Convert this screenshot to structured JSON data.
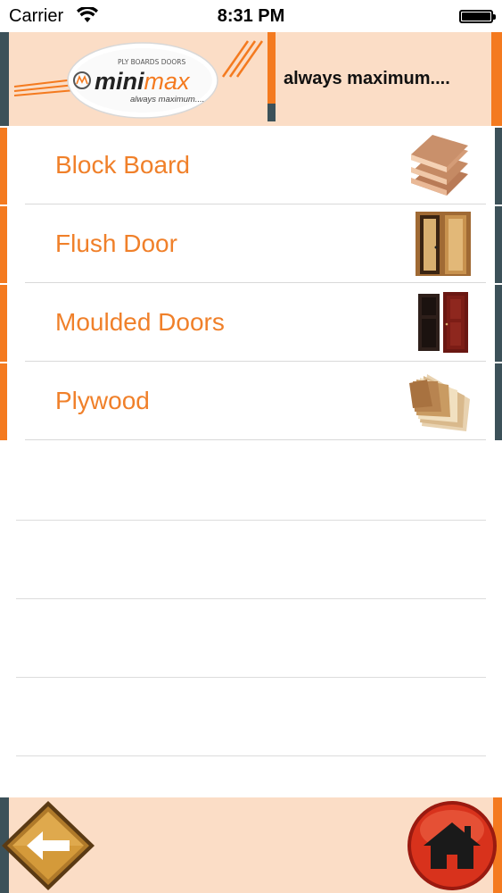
{
  "status_bar": {
    "carrier": "Carrier",
    "time": "8:31 PM"
  },
  "header": {
    "logo": {
      "top_text": "PLY  BOARDS  DOORS",
      "brand_part1": "mini",
      "brand_part2": "max",
      "tagline_small": "always maximum...."
    },
    "tagline": "always maximum...."
  },
  "products": [
    {
      "label": "Block Board",
      "thumb": "block-board-thumb"
    },
    {
      "label": "Flush Door",
      "thumb": "flush-door-thumb"
    },
    {
      "label": "Moulded Doors",
      "thumb": "moulded-doors-thumb"
    },
    {
      "label": "Plywood",
      "thumb": "plywood-thumb"
    }
  ],
  "footer": {
    "back_icon": "back-arrow-icon",
    "home_icon": "home-icon"
  },
  "colors": {
    "accent_orange": "#f47a1f",
    "slate": "#3c5159",
    "peach_bg": "#fbddc6",
    "label_orange": "#f0802a"
  }
}
